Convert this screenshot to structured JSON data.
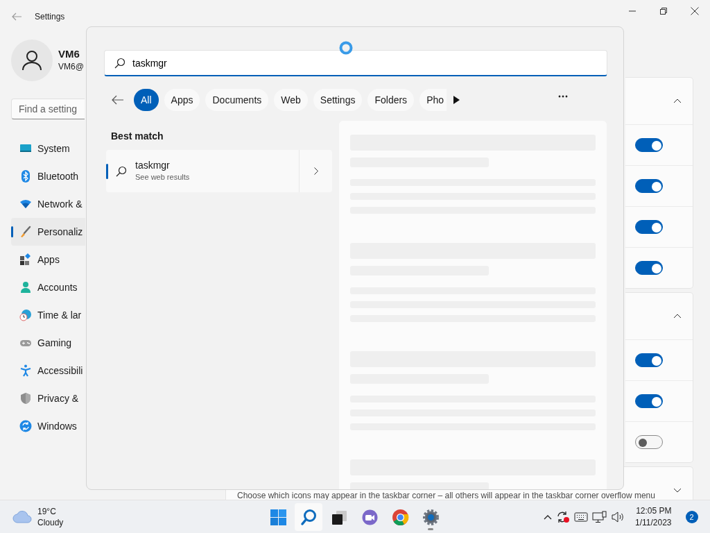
{
  "settings_window": {
    "title": "Settings",
    "user": {
      "name": "VM6",
      "email": "VM6@"
    },
    "search": {
      "placeholder": "Find a setting"
    },
    "nav": [
      {
        "kind": "system",
        "label": "System",
        "selected": false
      },
      {
        "kind": "bluetooth",
        "label": "Bluetooth",
        "selected": false
      },
      {
        "kind": "network",
        "label": "Network &",
        "selected": false
      },
      {
        "kind": "personalization",
        "label": "Personaliz",
        "selected": true
      },
      {
        "kind": "apps",
        "label": "Apps",
        "selected": false
      },
      {
        "kind": "accounts",
        "label": "Accounts",
        "selected": false
      },
      {
        "kind": "time",
        "label": "Time & lar",
        "selected": false
      },
      {
        "kind": "gaming",
        "label": "Gaming",
        "selected": false
      },
      {
        "kind": "accessibility",
        "label": "Accessibili",
        "selected": false
      },
      {
        "kind": "privacy",
        "label": "Privacy &",
        "selected": false
      },
      {
        "kind": "update",
        "label": "Windows",
        "selected": false
      }
    ],
    "cards": [
      {
        "expanded": true,
        "rows": [
          {
            "on": true
          },
          {
            "on": true
          },
          {
            "on": true
          },
          {
            "on": true
          }
        ]
      },
      {
        "expanded": true,
        "rows": [
          {
            "on": true
          },
          {
            "on": true
          },
          {
            "on": false
          }
        ]
      },
      {
        "expanded": false,
        "description": "Choose which icons may appear in the taskbar corner – all others will appear in the taskbar corner overflow menu"
      }
    ]
  },
  "search_flyout": {
    "query": "taskmgr",
    "filters": [
      {
        "label": "All",
        "selected": true
      },
      {
        "label": "Apps",
        "selected": false
      },
      {
        "label": "Documents",
        "selected": false
      },
      {
        "label": "Web",
        "selected": false
      },
      {
        "label": "Settings",
        "selected": false
      },
      {
        "label": "Folders",
        "selected": false
      },
      {
        "label": "Pho",
        "selected": false
      }
    ],
    "section": "Best match",
    "result": {
      "title": "taskmgr",
      "subtitle": "See web results"
    }
  },
  "taskbar": {
    "weather": {
      "temperature": "19°C",
      "condition": "Cloudy"
    },
    "apps": [
      {
        "kind": "start",
        "selected": false,
        "running": false
      },
      {
        "kind": "search",
        "selected": true,
        "running": false
      },
      {
        "kind": "taskview",
        "selected": false,
        "running": false
      },
      {
        "kind": "chat",
        "selected": false,
        "running": false
      },
      {
        "kind": "chrome",
        "selected": false,
        "running": false
      },
      {
        "kind": "settings",
        "selected": false,
        "running": true
      }
    ],
    "clock": {
      "time": "12:05 PM",
      "date": "1/11/2023"
    },
    "notifications": "2"
  }
}
